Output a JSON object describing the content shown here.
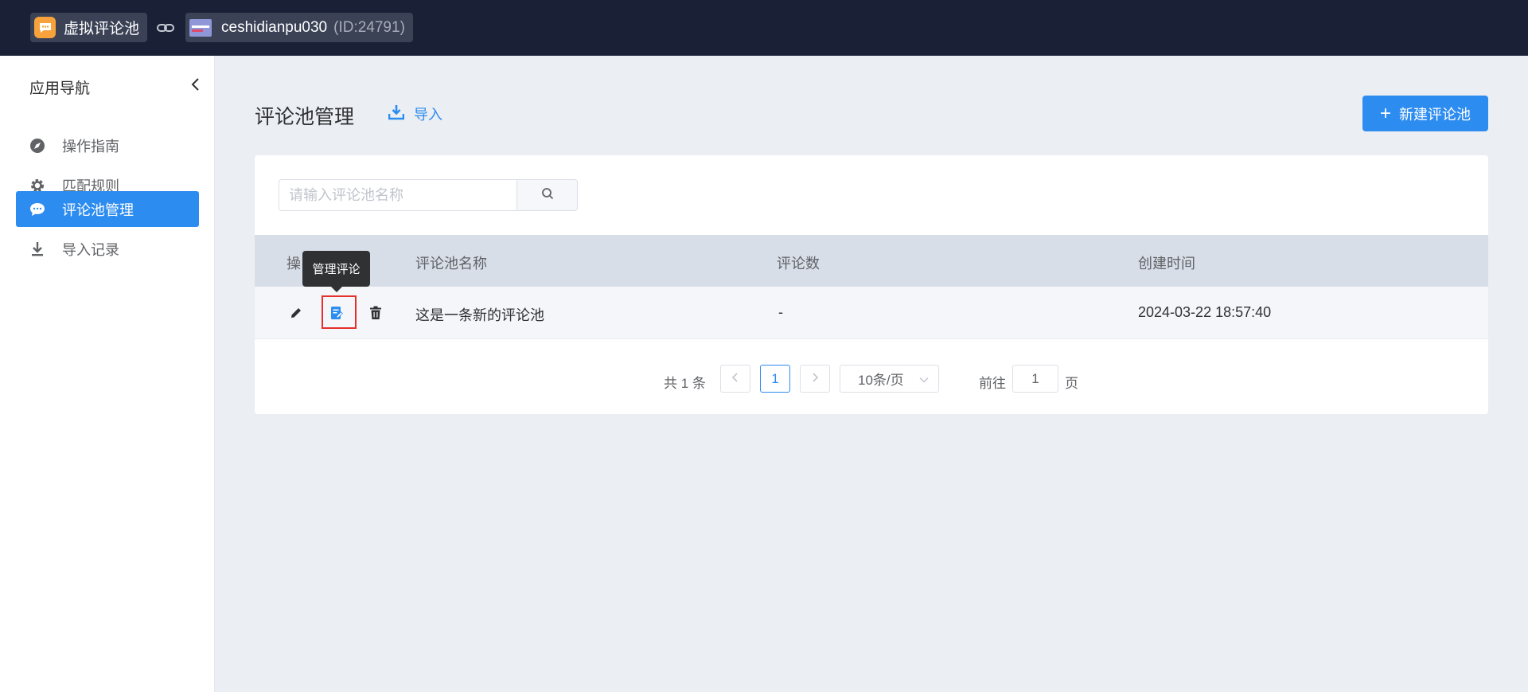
{
  "topbar": {
    "app_name": "虚拟评论池",
    "shop_name": "ceshidianpu030",
    "shop_id": "(ID:24791)"
  },
  "sidebar": {
    "title": "应用导航",
    "items": [
      {
        "label": "操作指南",
        "icon": "compass-icon",
        "active": false
      },
      {
        "label": "匹配规则",
        "icon": "gear-icon",
        "active": false
      },
      {
        "label": "评论池管理",
        "icon": "chat-icon",
        "active": true
      },
      {
        "label": "导入记录",
        "icon": "download-icon",
        "active": false
      }
    ]
  },
  "header": {
    "title": "评论池管理",
    "import_label": "导入",
    "new_button_label": "新建评论池"
  },
  "search": {
    "placeholder": "请输入评论池名称",
    "value": ""
  },
  "table": {
    "columns": [
      "操作",
      "评论池名称",
      "评论数",
      "创建时间"
    ],
    "op_header_visible": "操",
    "rows": [
      {
        "name": "这是一条新的评论池",
        "count": "-",
        "created": "2024-03-22 18:57:40"
      }
    ]
  },
  "tooltip": {
    "text": "管理评论"
  },
  "pagination": {
    "total_label": "共 1 条",
    "current_page": "1",
    "page_size": "10条/页",
    "goto_prefix": "前往",
    "goto_value": "1",
    "goto_suffix": "页"
  },
  "colors": {
    "primary": "#2d8cf0",
    "topbar": "#1a2035",
    "highlight_border": "#e5302c"
  }
}
